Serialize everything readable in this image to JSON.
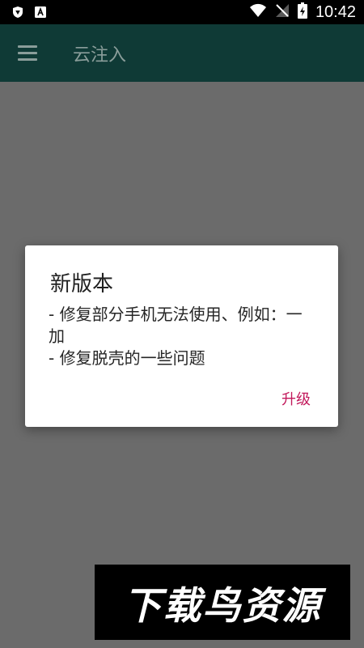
{
  "status_bar": {
    "time": "10:42",
    "icons": [
      "shield-icon",
      "a-icon",
      "wifi-icon",
      "no-signal-icon",
      "battery-charging-icon"
    ]
  },
  "app_bar": {
    "title": "云注入",
    "menu_icon": "menu-icon"
  },
  "dialog": {
    "title": "新版本",
    "message": "- 修复部分手机无法使用、例如：一加\n- 修复脱壳的一些问题",
    "button_label": "升级"
  },
  "watermark": {
    "text": "下载鸟资源"
  },
  "colors": {
    "status_bar": "#000000",
    "app_bar": "#0f3a36",
    "overlay": "#6b6b6b",
    "dialog": "#ffffff",
    "accent": "#c2185b"
  }
}
